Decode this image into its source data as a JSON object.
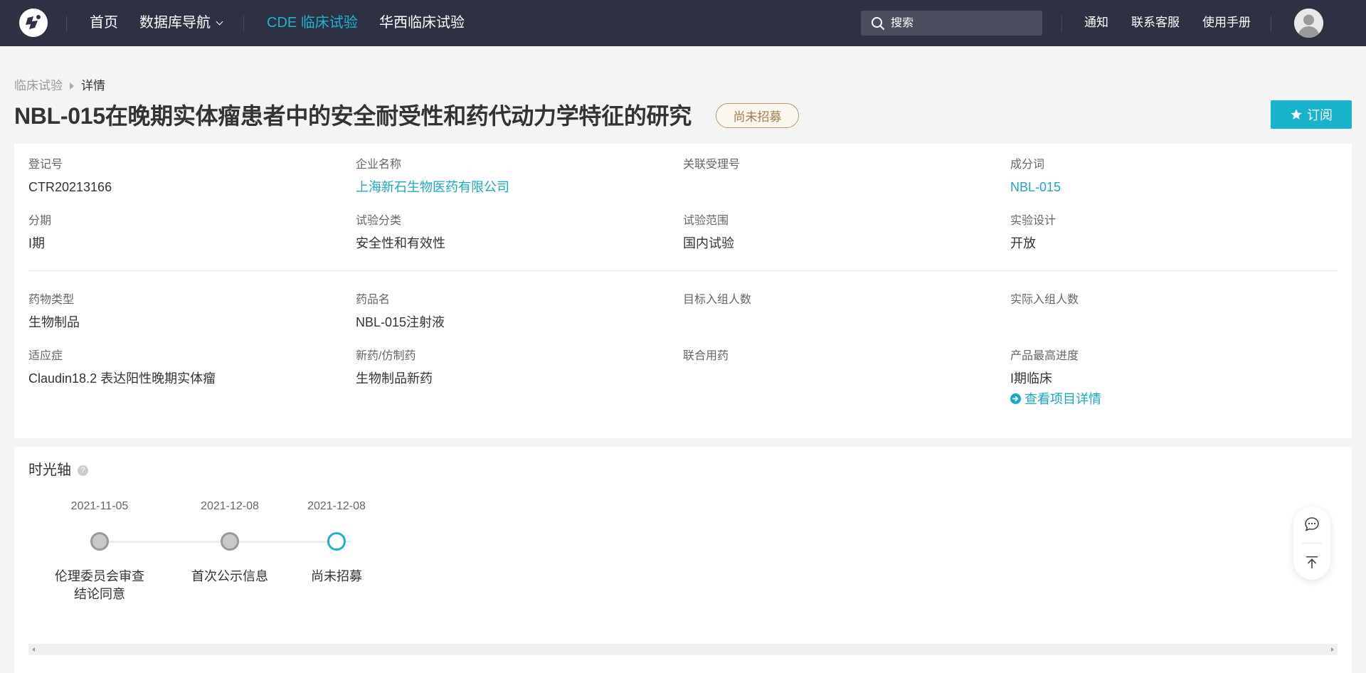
{
  "nav": {
    "home": "首页",
    "db_nav": "数据库导航",
    "cde": "CDE 临床试验",
    "huaxi": "华西临床试验",
    "search_placeholder": "搜索",
    "notify": "通知",
    "service": "联系客服",
    "manual": "使用手册"
  },
  "breadcrumb": {
    "root": "临床试验",
    "current": "详情"
  },
  "page": {
    "title": "NBL-015在晚期实体瘤患者中的安全耐受性和药代动力学特征的研究",
    "status": "尚未招募",
    "subscribe": "订阅"
  },
  "fields": {
    "reg_no": {
      "label": "登记号",
      "value": "CTR20213166"
    },
    "company": {
      "label": "企业名称",
      "value": "上海新石生物医药有限公司"
    },
    "related_no": {
      "label": "关联受理号",
      "value": ""
    },
    "ingredient": {
      "label": "成分词",
      "value": "NBL-015"
    },
    "phase": {
      "label": "分期",
      "value": "I期"
    },
    "trial_type": {
      "label": "试验分类",
      "value": "安全性和有效性"
    },
    "scope": {
      "label": "试验范围",
      "value": "国内试验"
    },
    "design": {
      "label": "实验设计",
      "value": "开放"
    },
    "drug_type": {
      "label": "药物类型",
      "value": "生物制品"
    },
    "drug_name": {
      "label": "药品名",
      "value": "NBL-015注射液"
    },
    "target_enroll": {
      "label": "目标入组人数",
      "value": ""
    },
    "actual_enroll": {
      "label": "实际入组人数",
      "value": ""
    },
    "indication": {
      "label": "适应症",
      "value": "Claudin18.2 表达阳性晚期实体瘤"
    },
    "new_generic": {
      "label": "新药/仿制药",
      "value": "生物制品新药"
    },
    "combo": {
      "label": "联合用药",
      "value": ""
    },
    "max_progress": {
      "label": "产品最高进度",
      "value": "I期临床",
      "link": "查看项目详情"
    }
  },
  "timeline": {
    "title": "时光轴",
    "help": "?",
    "events": [
      {
        "date": "2021-11-05",
        "label_line1": "伦理委员会审查",
        "label_line2": "结论同意",
        "state": "done"
      },
      {
        "date": "2021-12-08",
        "label_line1": "首次公示信息",
        "label_line2": "",
        "state": "done"
      },
      {
        "date": "2021-12-08",
        "label_line1": "尚未招募",
        "label_line2": "",
        "state": "current"
      }
    ]
  },
  "colors": {
    "nav_bg": "#2d3143",
    "accent": "#1ab3cc",
    "link": "#1aa8c3",
    "status_border": "#b79a6e"
  },
  "icons": {
    "logo": "logo-icon",
    "search": "search-icon",
    "chevron": "chevron-down-icon",
    "star": "star-icon",
    "arrow_circle": "arrow-circle-right-icon",
    "chat": "chat-icon",
    "to_top": "back-to-top-icon",
    "avatar": "user-avatar-icon"
  }
}
